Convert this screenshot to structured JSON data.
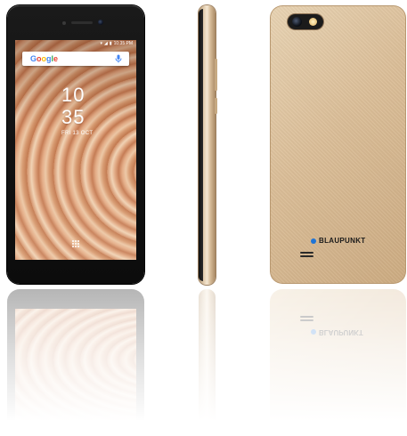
{
  "front_phone": {
    "status_bar": {
      "time": "10:35 PM",
      "icons": [
        "wifi-icon",
        "signal-icon",
        "battery-icon"
      ]
    },
    "search_bar": {
      "logo_text": "Google",
      "logo_colors": [
        "#4285F4",
        "#EA4335",
        "#FBBC05",
        "#4285F4",
        "#34A853",
        "#EA4335"
      ],
      "mic_icon": "mic-icon"
    },
    "clock": {
      "hour": "10",
      "minute": "35",
      "date": "FRI 13 OCT"
    },
    "app_drawer_icon": "app-drawer-icon"
  },
  "back_phone": {
    "brand": "BLAUPUNKT",
    "brand_dot_color": "#1f74d6",
    "body_color": "#dcbf99"
  },
  "side_phone": {
    "body_color": "#e6d2b6"
  }
}
